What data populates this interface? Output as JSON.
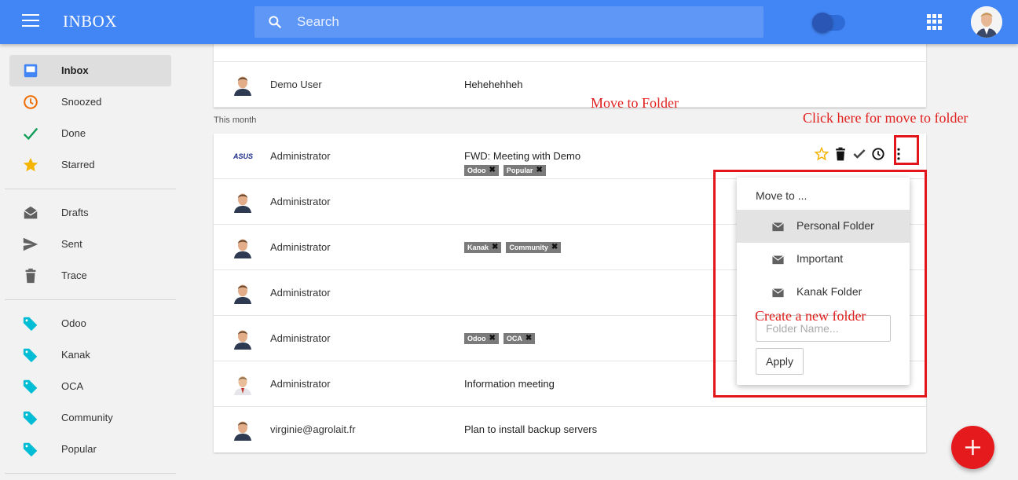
{
  "header": {
    "title": "INBOX",
    "search_placeholder": "Search",
    "brand_color": "#4285f4"
  },
  "sidebar": {
    "items": [
      {
        "label": "Inbox",
        "icon": "inbox-icon",
        "color": "#4285f4",
        "active": true
      },
      {
        "label": "Snoozed",
        "icon": "clock-icon",
        "color": "#ef6c00"
      },
      {
        "label": "Done",
        "icon": "check-icon",
        "color": "#0f9d58"
      },
      {
        "label": "Starred",
        "icon": "star-icon",
        "color": "#f4b400"
      },
      {
        "label": "Drafts",
        "icon": "drafts-icon",
        "color": "#616161"
      },
      {
        "label": "Sent",
        "icon": "send-icon",
        "color": "#616161"
      },
      {
        "label": "Trace",
        "icon": "trash-icon",
        "color": "#616161"
      },
      {
        "label": "Odoo",
        "icon": "label-icon",
        "color": "#00bcd4"
      },
      {
        "label": "Kanak",
        "icon": "label-icon",
        "color": "#00bcd4"
      },
      {
        "label": "OCA",
        "icon": "label-icon",
        "color": "#00bcd4"
      },
      {
        "label": "Community",
        "icon": "label-icon",
        "color": "#00bcd4"
      },
      {
        "label": "Popular",
        "icon": "label-icon",
        "color": "#00bcd4"
      }
    ]
  },
  "top_list": [
    {
      "sender": "Demo User",
      "subject": "Hehehehheh"
    }
  ],
  "section_label": "This month",
  "month_list": [
    {
      "sender": "Administrator",
      "subject": "FWD: Meeting with Demo",
      "tags": [
        "Odoo",
        "Popular"
      ],
      "avatar": "asus-logo"
    },
    {
      "sender": "Administrator",
      "subject": "",
      "tags": []
    },
    {
      "sender": "Administrator",
      "subject": "",
      "tags": [
        "Kanak",
        "Community"
      ]
    },
    {
      "sender": "Administrator",
      "subject": "",
      "tags": []
    },
    {
      "sender": "Administrator",
      "subject": "",
      "tags": [
        "Odoo",
        "OCA"
      ]
    },
    {
      "sender": "Administrator",
      "subject": "Information meeting",
      "tags": []
    },
    {
      "sender": "virginie@agrolait.fr",
      "subject": "Plan to install backup servers",
      "tags": []
    }
  ],
  "menu": {
    "title": "Move to ...",
    "folders": [
      "Personal Folder",
      "Important",
      "Kanak Folder"
    ],
    "folder_name_placeholder": "Folder Name...",
    "apply_label": "Apply"
  },
  "annotations": {
    "move_to_folder": "Move to Folder",
    "click_here": "Click here for move to folder",
    "create_folder": "Create a new folder",
    "color": "#e0201e"
  }
}
